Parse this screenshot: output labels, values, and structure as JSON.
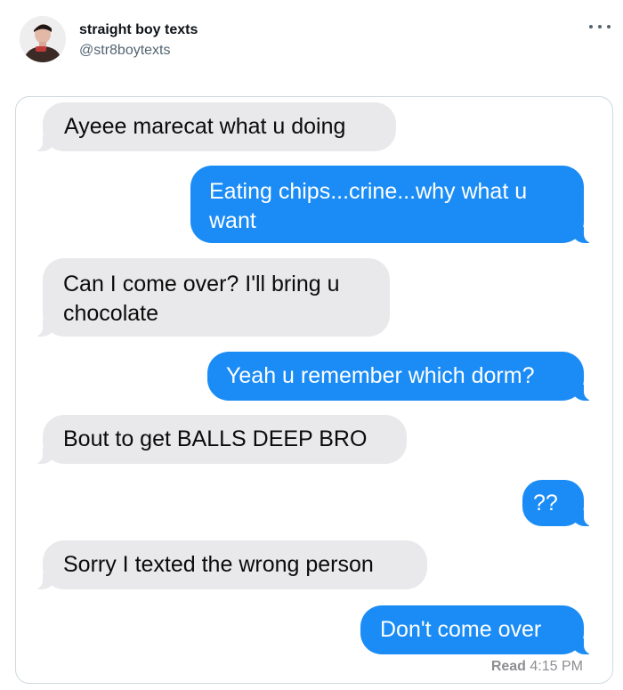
{
  "author": {
    "name": "straight boy texts",
    "handle": "@str8boytexts"
  },
  "messages": [
    {
      "direction": "in",
      "text": "Ayeee marecat what u doing"
    },
    {
      "direction": "out",
      "text": "Eating chips...crine...why what u want"
    },
    {
      "direction": "in",
      "text": "Can I come over? I'll bring u chocolate"
    },
    {
      "direction": "out",
      "text": "Yeah u remember which dorm?"
    },
    {
      "direction": "in",
      "text": "Bout to get BALLS DEEP BRO"
    },
    {
      "direction": "out",
      "text": "??"
    },
    {
      "direction": "in",
      "text": "Sorry I texted the wrong person"
    },
    {
      "direction": "out",
      "text": "Don't come over"
    }
  ],
  "receipt": {
    "status": "Read",
    "time": "4:15 PM"
  },
  "colors": {
    "incoming_bubble": "#e9e9eb",
    "outgoing_bubble": "#1b8cf5"
  },
  "icons": [
    "avatar",
    "more-icon"
  ]
}
